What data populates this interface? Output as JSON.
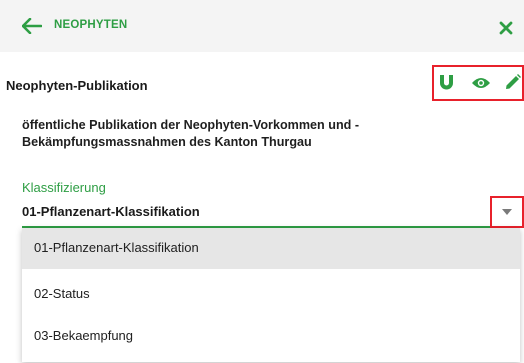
{
  "header": {
    "title": "NEOPHYTEN",
    "back_icon": "arrow-left-icon",
    "close_icon": "close-icon",
    "accent_color": "#2e9e44"
  },
  "layer": {
    "title": "Neophyten-Publikation",
    "actions": [
      "magnet-icon",
      "eye-icon",
      "pencil-icon"
    ],
    "description": "öffentliche Publikation der Neophyten-Vorkommen und -Bekämpfungsmassnahmen des Kanton Thurgau"
  },
  "classification": {
    "label": "Klassifizierung",
    "selected": "01-Pflanzenart-Klassifikation",
    "options": [
      "01-Pflanzenart-Klassifikation",
      "02-Status",
      "03-Bekaempfung"
    ]
  },
  "highlight_color": "#e8212b"
}
